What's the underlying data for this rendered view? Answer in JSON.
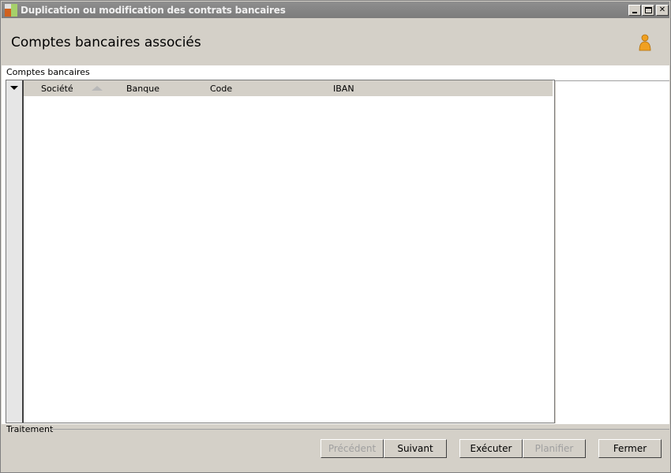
{
  "window": {
    "title": "Duplication ou modification des contrats bancaires"
  },
  "header": {
    "page_title": "Comptes bancaires associés",
    "help_icon": "person-help-icon"
  },
  "section": {
    "label": "Comptes bancaires"
  },
  "grid": {
    "columns": [
      "Société",
      "Banque",
      "Code",
      "IBAN"
    ],
    "rows": []
  },
  "footer": {
    "label": "Traitement",
    "buttons": {
      "previous": "Précédent",
      "next": "Suivant",
      "execute": "Exécuter",
      "schedule": "Planifier",
      "close": "Fermer"
    }
  },
  "colors": {
    "titlebar": "#808080",
    "chrome": "#d4d0c8",
    "help_icon": "#f0a020"
  }
}
